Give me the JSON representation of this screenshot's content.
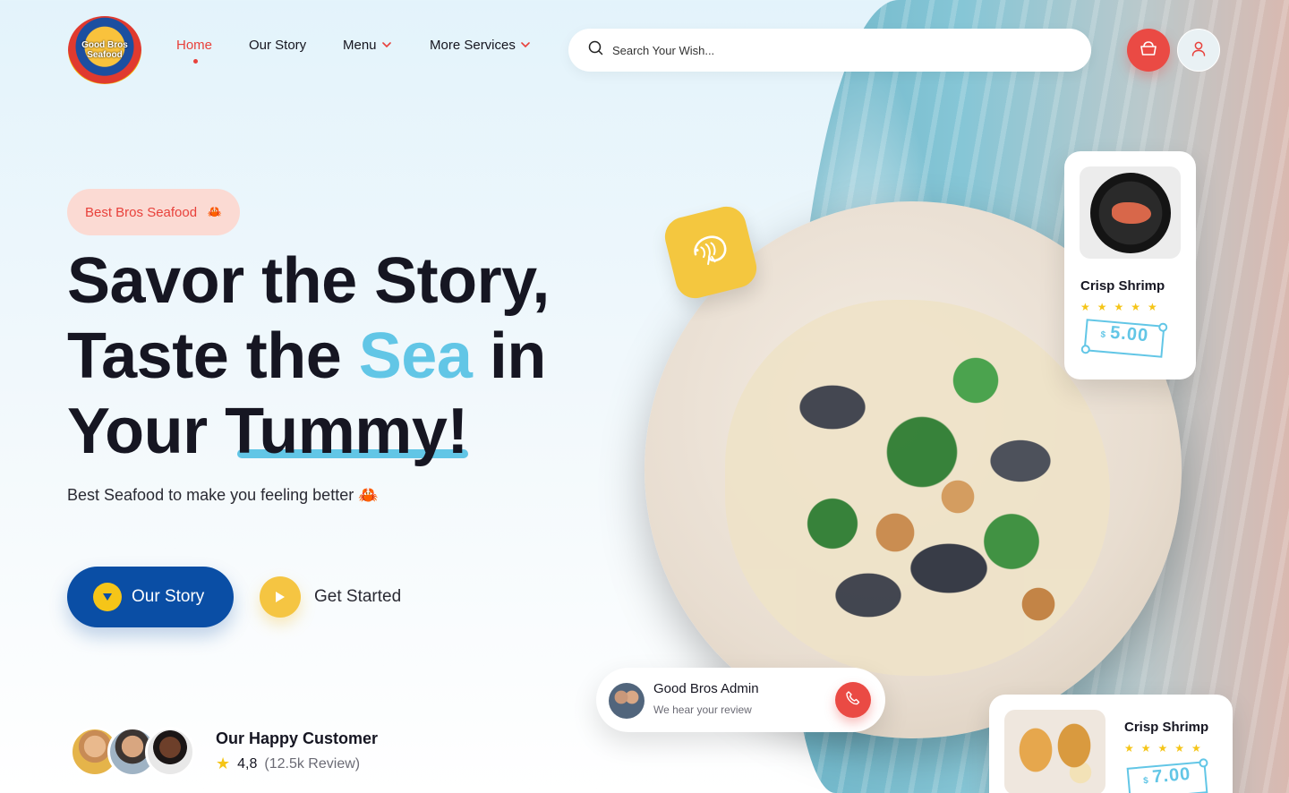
{
  "brand": {
    "logo_text": "Good Bros Seafood",
    "colors": {
      "accent_red": "#e8413b",
      "brand_blue": "#0a4ea5",
      "accent_cyan": "#62c6e6",
      "accent_yellow": "#f5c518"
    }
  },
  "nav": {
    "items": [
      {
        "label": "Home",
        "active": true,
        "has_dropdown": false
      },
      {
        "label": "Our Story",
        "active": false,
        "has_dropdown": false
      },
      {
        "label": "Menu",
        "active": false,
        "has_dropdown": true
      },
      {
        "label": "More Services",
        "active": false,
        "has_dropdown": true
      }
    ]
  },
  "search": {
    "placeholder": "Search Your Wish...",
    "value": "",
    "icon": "search-icon"
  },
  "header_actions": {
    "cart_icon": "basket-icon",
    "user_icon": "user-icon"
  },
  "hero": {
    "tag": "Best Bros Seafood",
    "tag_icon": "crab-icon",
    "headline_line1": "Savor the Story,",
    "headline_line2_a": "Taste the ",
    "headline_line2_highlight": "Sea",
    "headline_line2_b": " in",
    "headline_line3_a": "Your ",
    "headline_line3_highlight": "Tummy!",
    "subline": "Best Seafood to make you feeling better 🦀",
    "primary_button": "Our Story",
    "secondary_button": "Get Started"
  },
  "customers": {
    "title": "Our Happy Customer",
    "rating": "4,8",
    "reviews": "(12.5k Review)"
  },
  "products": [
    {
      "name": "Crisp Shrimp",
      "rating": 5,
      "currency": "$",
      "price": "5.00"
    },
    {
      "name": "Crisp Shrimp",
      "rating": 5,
      "currency": "$",
      "price": "7.00"
    }
  ],
  "admin_card": {
    "name": "Good Bros Admin",
    "subtitle": "We hear your review",
    "call_icon": "phone-icon"
  }
}
